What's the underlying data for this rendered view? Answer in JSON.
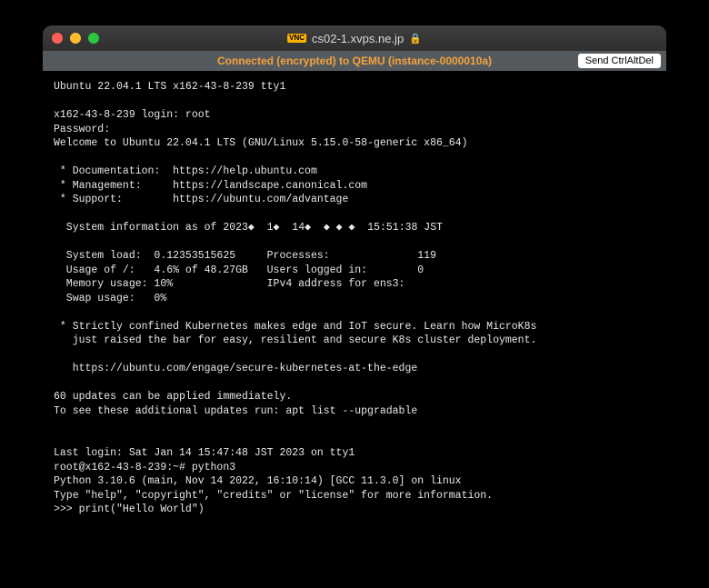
{
  "window": {
    "vnc_badge": "VNC",
    "title": "cs02-1.xvps.ne.jp",
    "lock_glyph": "🔒"
  },
  "statusbar": {
    "connection_text": "Connected (encrypted) to QEMU (instance-0000010a)",
    "cad_button_label": "Send CtrlAltDel"
  },
  "terminal": {
    "lines": [
      "Ubuntu 22.04.1 LTS x162-43-8-239 tty1",
      "",
      "x162-43-8-239 login: root",
      "Password:",
      "Welcome to Ubuntu 22.04.1 LTS (GNU/Linux 5.15.0-58-generic x86_64)",
      "",
      " * Documentation:  https://help.ubuntu.com",
      " * Management:     https://landscape.canonical.com",
      " * Support:        https://ubuntu.com/advantage",
      "",
      "  System information as of 2023◆  1◆  14◆  ◆ ◆ ◆  15:51:38 JST",
      "",
      "  System load:  0.12353515625     Processes:              119",
      "  Usage of /:   4.6% of 48.27GB   Users logged in:        0",
      "  Memory usage: 10%               IPv4 address for ens3:",
      "  Swap usage:   0%",
      "",
      " * Strictly confined Kubernetes makes edge and IoT secure. Learn how MicroK8s",
      "   just raised the bar for easy, resilient and secure K8s cluster deployment.",
      "",
      "   https://ubuntu.com/engage/secure-kubernetes-at-the-edge",
      "",
      "60 updates can be applied immediately.",
      "To see these additional updates run: apt list --upgradable",
      "",
      "",
      "Last login: Sat Jan 14 15:47:48 JST 2023 on tty1",
      "root@x162-43-8-239:~# python3",
      "Python 3.10.6 (main, Nov 14 2022, 16:10:14) [GCC 11.3.0] on linux",
      "Type \"help\", \"copyright\", \"credits\" or \"license\" for more information.",
      ">>> print(\"Hello World\")"
    ]
  }
}
